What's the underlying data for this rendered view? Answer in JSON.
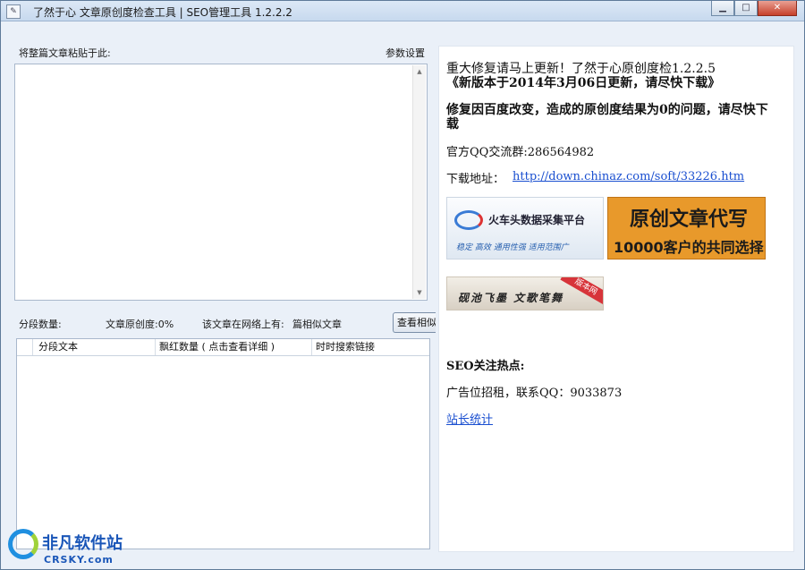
{
  "window": {
    "title": "了然于心 文章原创度检查工具 | SEO管理工具  1.2.2.2",
    "icon": "app-icon",
    "controls": {
      "minimize": "▁",
      "maximize": "□",
      "close": "✕"
    }
  },
  "left": {
    "paste_label": "将整篇文章粘贴于此:",
    "settings_link": "参数设置",
    "article_text": "",
    "segments_label": "分段数量:",
    "originality_label": "文章原创度:0%",
    "online_label": "该文章在网络上有:",
    "similar_label": "篇相似文章",
    "view_similar_button": "查看相似",
    "table": {
      "columns": [
        "分段文本",
        "飘红数量 ( 点击查看详细 )",
        "时时搜索链接"
      ],
      "rows": []
    }
  },
  "right": {
    "notice_line1": "重大修复请马上更新！了然于心原创度检1.2.2.5",
    "notice_line2": "《新版本于2014年3月06日更新，请尽快下载》",
    "fix_line1": "修复因百度改变，造成的原创度结果为0的问题，请尽快下",
    "fix_line2": "载",
    "qq_group_label": "官方QQ交流群:286564982",
    "download_label": "下载地址：",
    "download_link": "http://down.chinaz.com/soft/33226.htm",
    "ad1_title": "火车头数据采集平台",
    "ad1_tagline": "稳定  高效  通用性强  适用范围广",
    "ad2_title": "原创文章代写",
    "ad2_subtitle": "10000客户的共同选择",
    "ad3_text": "砚池飞墨  文歌笔舞",
    "ad3_tag": "版本网",
    "seo_heading": "SEO关注热点:",
    "ad_rent": "广告位招租，联系QQ：9033873",
    "stats_link": "站长统计"
  },
  "watermark": {
    "name": "非凡软件站",
    "domain": "CRSKY.com"
  }
}
